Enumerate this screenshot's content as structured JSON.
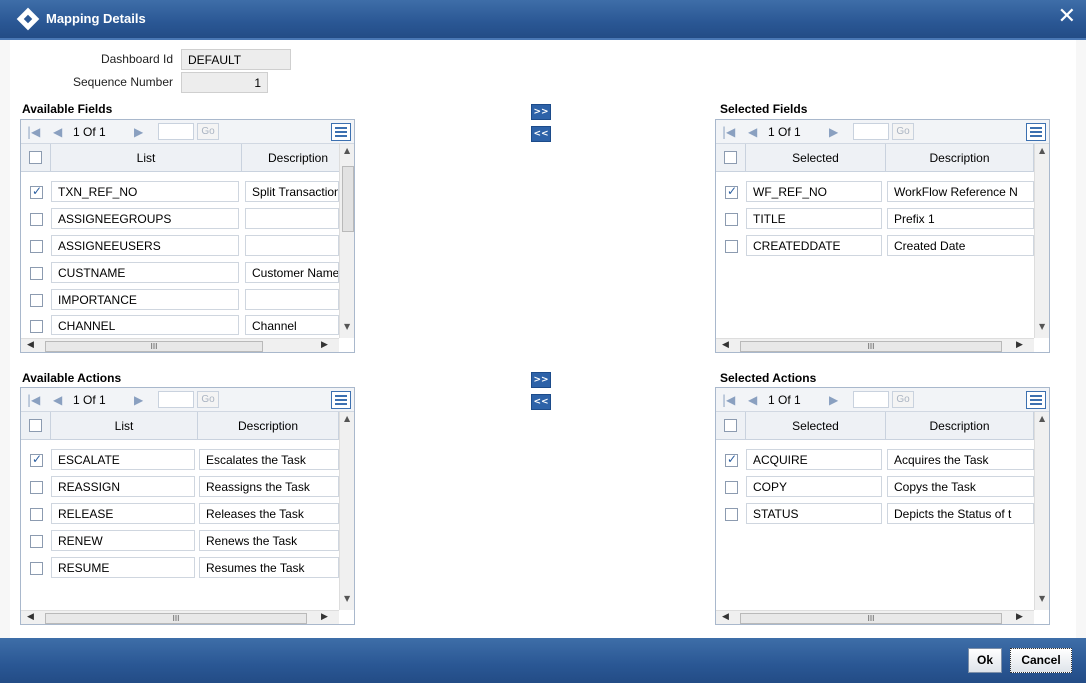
{
  "window": {
    "title": "Mapping Details",
    "close_label": "✕"
  },
  "form": {
    "dashboard_label": "Dashboard Id",
    "dashboard_value": "DEFAULT",
    "sequence_label": "Sequence Number",
    "sequence_value": "1"
  },
  "pager": {
    "page_text": "1 Of 1",
    "go_label": "Go"
  },
  "move": {
    "right": ">>",
    "left": "<<"
  },
  "scroll": {
    "thumb": "III"
  },
  "available_fields": {
    "title": "Available Fields",
    "headers": [
      "List",
      "Description"
    ],
    "rows": [
      {
        "checked": true,
        "name": "TXN_REF_NO",
        "desc": "Split Transaction"
      },
      {
        "checked": false,
        "name": "ASSIGNEEGROUPS",
        "desc": ""
      },
      {
        "checked": false,
        "name": "ASSIGNEEUSERS",
        "desc": ""
      },
      {
        "checked": false,
        "name": "CUSTNAME",
        "desc": "Customer Name"
      },
      {
        "checked": false,
        "name": "IMPORTANCE",
        "desc": ""
      },
      {
        "checked": false,
        "name": "CHANNEL",
        "desc": "Channel"
      }
    ]
  },
  "selected_fields": {
    "title": "Selected Fields",
    "headers": [
      "Selected",
      "Description"
    ],
    "rows": [
      {
        "checked": true,
        "name": "WF_REF_NO",
        "desc": "WorkFlow Reference N"
      },
      {
        "checked": false,
        "name": "TITLE",
        "desc": "Prefix 1"
      },
      {
        "checked": false,
        "name": "CREATEDDATE",
        "desc": "Created Date"
      }
    ]
  },
  "available_actions": {
    "title": "Available Actions",
    "headers": [
      "List",
      "Description"
    ],
    "rows": [
      {
        "checked": true,
        "name": "ESCALATE",
        "desc": "Escalates the Task"
      },
      {
        "checked": false,
        "name": "REASSIGN",
        "desc": "Reassigns the Task"
      },
      {
        "checked": false,
        "name": "RELEASE",
        "desc": "Releases the Task"
      },
      {
        "checked": false,
        "name": "RENEW",
        "desc": "Renews the Task"
      },
      {
        "checked": false,
        "name": "RESUME",
        "desc": "Resumes the Task"
      }
    ]
  },
  "selected_actions": {
    "title": "Selected Actions",
    "headers": [
      "Selected",
      "Description"
    ],
    "rows": [
      {
        "checked": true,
        "name": "ACQUIRE",
        "desc": "Acquires the Task"
      },
      {
        "checked": false,
        "name": "COPY",
        "desc": "Copys the Task"
      },
      {
        "checked": false,
        "name": "STATUS",
        "desc": "Depicts the Status of t"
      }
    ]
  },
  "footer": {
    "ok_label": "Ok",
    "cancel_label": "Cancel"
  },
  "colors": {
    "titlebar": "#2a5794",
    "button_blue": "#2d62a8",
    "panel_border": "#a9b8cc"
  }
}
